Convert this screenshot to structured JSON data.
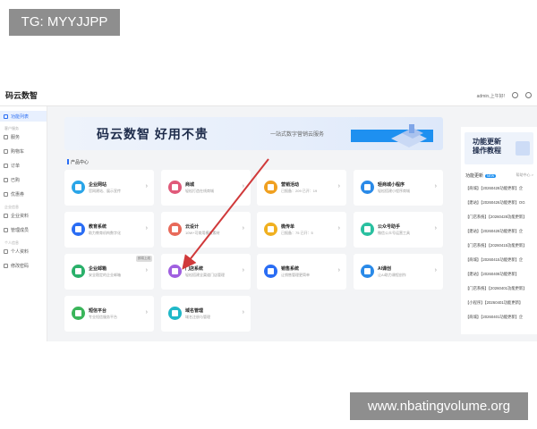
{
  "watermark_top": "TG: MYYJJPP",
  "watermark_bottom": "www.nbatingvolume.org",
  "header": {
    "brand": "码云数智",
    "user": "admin,上午好!",
    "help": "?",
    "account": "A"
  },
  "sidebar": {
    "items": [
      {
        "label": "功能列表",
        "active": true
      },
      {
        "label": "服务",
        "group_before": "客户服务"
      },
      {
        "label": "购物车"
      },
      {
        "label": "订单"
      },
      {
        "label": "已购"
      },
      {
        "label": "优惠券"
      },
      {
        "label": "企业资料",
        "group_before": "企业信息"
      },
      {
        "label": "管理成员"
      },
      {
        "label": "个人资料",
        "group_before": "个人信息"
      },
      {
        "label": "修改密码"
      }
    ]
  },
  "banner": {
    "title": "码云数智  好用不贵",
    "subtitle": "一站式数字营销云服务"
  },
  "section": {
    "title": "产品中心"
  },
  "products": [
    {
      "title": "企业网站",
      "desc": "官网建站、展示宣传",
      "color": "#2aa5e8"
    },
    {
      "title": "商城",
      "desc": "轻松打造在线商城",
      "color": "#e05a7a"
    },
    {
      "title": "营销活动",
      "desc": "已报备：209  已开：19",
      "color": "#f0a020"
    },
    {
      "title": "轻商城小程序",
      "desc": "轻松搭建小程序商城",
      "color": "#2a8ae8"
    },
    {
      "title": "教育系统",
      "desc": "助力教育机构数字化",
      "color": "#2a6df4"
    },
    {
      "title": "云设计",
      "desc": "10W+可商用模板素材",
      "color": "#e86a5a"
    },
    {
      "title": "微传单",
      "desc": "已报备：75  已开：5",
      "color": "#f0b020"
    },
    {
      "title": "公众号助手",
      "desc": "微信公众号运营工具",
      "color": "#2ac0a0"
    },
    {
      "title": "企业邮箱",
      "desc": "安全稳定的企业邮箱",
      "color": "#2ab06a",
      "tag": "即将上线"
    },
    {
      "title": "门店系统",
      "desc": "轻松搭建全渠道门店管理",
      "color": "#a060e0"
    },
    {
      "title": "销售系统",
      "desc": "让销售管理更简单",
      "color": "#2a6df4"
    },
    {
      "title": "AI课创",
      "desc": "让AI助力课程创作",
      "color": "#2a8ae8"
    },
    {
      "title": "短信平台",
      "desc": "专业短信服务平台",
      "color": "#3ab55a"
    },
    {
      "title": "域名管理",
      "desc": "域名注册与管理",
      "color": "#20b8c8"
    }
  ],
  "right_panel": {
    "hero_title_1": "功能更新",
    "hero_title_2": "操作教程",
    "head": "功能更新",
    "new_badge": "NEW",
    "more": "帮助中心 >",
    "rows": [
      "【商城】【20260428功能更新】企",
      "【建站】【20260426功能更新】OG",
      "【门店系统】【20260428功能更新】",
      "【建站】【20260428功能更新】企",
      "【门店系统】【20260415功能更新】",
      "【商城】【20260415功能更新】企",
      "【建站】【20260408功能更新】",
      "【门店系统】【20260401功能更新】",
      "【小程序】【20260401功能更新】",
      "【商城】【20260401功能更新】企"
    ]
  }
}
